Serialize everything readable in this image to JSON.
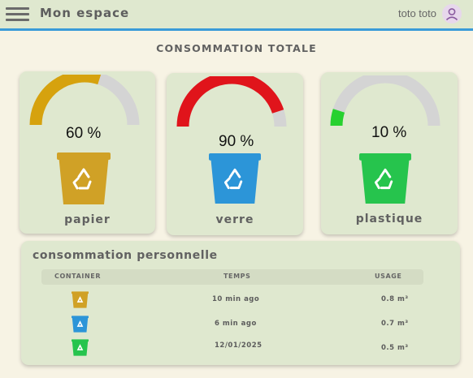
{
  "header": {
    "title": "Mon espace",
    "user_name": "toto toto",
    "menu_icon": "hamburger-menu-icon",
    "avatar_icon": "user-icon"
  },
  "totale": {
    "title": "CONSOMMATION TOTALE",
    "cards": [
      {
        "label": "papier",
        "percent": 60,
        "percent_text": "60 %",
        "color": "#d6a20e",
        "bin_color": "#d0a126"
      },
      {
        "label": "verre",
        "percent": 90,
        "percent_text": "90 %",
        "color": "#e0141b",
        "bin_color": "#2c95d8"
      },
      {
        "label": "plastique",
        "percent": 10,
        "percent_text": "10 %",
        "color": "#27d12f",
        "bin_color": "#26c44d"
      }
    ],
    "gauge_track_color": "#d4d4d4"
  },
  "personnelle": {
    "title": "consommation personnelle",
    "columns": [
      "CONTAINER",
      "TEMPS",
      "USAGE"
    ],
    "rows": [
      {
        "container": "papier",
        "bin_color": "#d0a126",
        "temps": "10 min ago",
        "usage": "0.8 m³"
      },
      {
        "container": "verre",
        "bin_color": "#2c95d8",
        "temps": "6 min ago",
        "usage": "0.7 m³"
      },
      {
        "container": "plastique",
        "bin_color": "#26c44d",
        "temps": "12/01/2025",
        "usage": "0.5 m³"
      }
    ]
  }
}
